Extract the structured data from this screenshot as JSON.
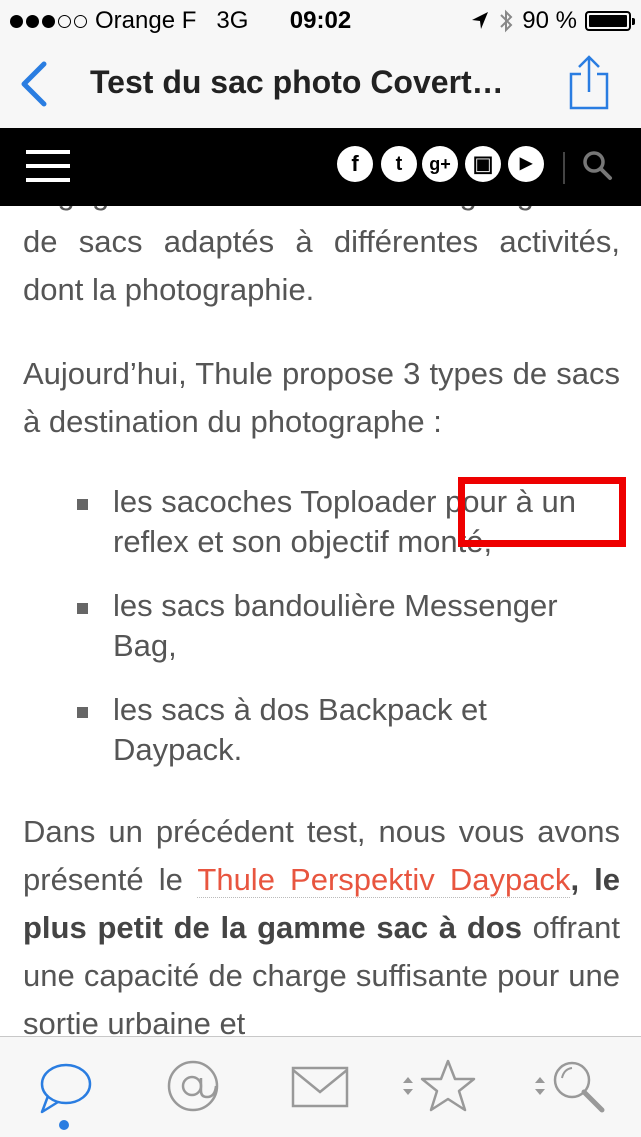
{
  "status_bar": {
    "carrier": "Orange F",
    "network": "3G",
    "time": "09:02",
    "battery": "90 %",
    "signal_bars_filled": 3,
    "signal_bars_total": 5
  },
  "nav": {
    "title": "Test du sac photo Covert…",
    "back_icon": "chevron-left-icon",
    "share_icon": "share-icon",
    "accent_color": "#2a7de1"
  },
  "site_bar": {
    "menu_icon": "hamburger-icon",
    "social": [
      {
        "name": "facebook-icon",
        "glyph": "f"
      },
      {
        "name": "twitter-icon",
        "glyph": "t"
      },
      {
        "name": "google-plus-icon",
        "glyph": "g+"
      },
      {
        "name": "instagram-icon",
        "glyph": "▣"
      },
      {
        "name": "youtube-icon",
        "glyph": "▶"
      }
    ],
    "search_icon": "search-icon"
  },
  "article": {
    "p1_fragment": "bagagerie en offrant une large gamme",
    "p1_rest": "de sacs adaptés à différentes activités, dont la photographie.",
    "p2": "Aujourd’hui, Thule propose 3 types de sacs à destination du photographe :",
    "list": [
      "les sacoches Toploader pour à un reflex et son objectif monté,",
      "les sacs bandoulière Messenger Bag,",
      "les sacs à dos Backpack et Daypack."
    ],
    "p3_start": "Dans un précédent test, nous vous avons présenté le ",
    "p3_link": "Thule Perspektiv Daypack",
    "p3_bold": ", le plus petit de la gamme sac à dos",
    "p3_end": " offrant une capacité de charge suffisante pour une sortie urbaine et"
  },
  "highlight": {
    "color": "#ee0000"
  },
  "tab_bar": {
    "tabs": [
      {
        "name": "tab-messages",
        "icon": "speech-bubble-icon",
        "active": true
      },
      {
        "name": "tab-mentions",
        "icon": "at-sign-icon",
        "active": false
      },
      {
        "name": "tab-mail",
        "icon": "envelope-icon",
        "active": false
      },
      {
        "name": "tab-favorites",
        "icon": "star-icon",
        "active": false
      },
      {
        "name": "tab-search",
        "icon": "magnifier-icon",
        "active": false
      }
    ]
  }
}
